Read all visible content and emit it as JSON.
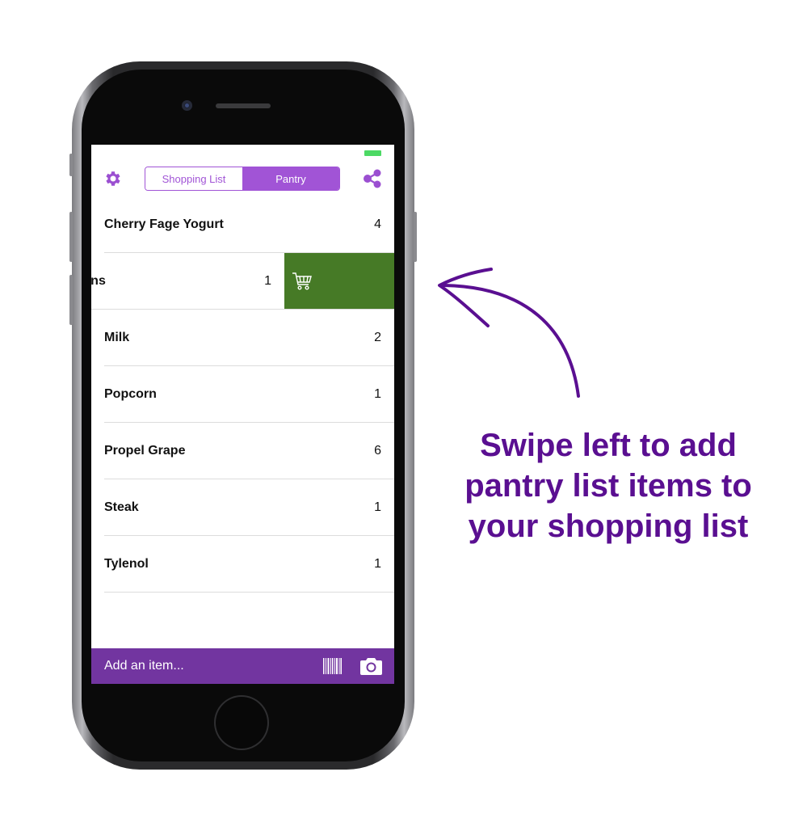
{
  "nav": {
    "segments": [
      {
        "label": "Shopping List",
        "active": false
      },
      {
        "label": "Pantry",
        "active": true
      }
    ],
    "settings_icon": "gear-icon",
    "share_icon": "share-icon"
  },
  "list": {
    "items": [
      {
        "name": "Cherry Fage Yogurt",
        "qty": "4"
      },
      {
        "name": "e Espresso Beans",
        "qty": "1",
        "swiped": true,
        "action_icon": "cart-icon"
      },
      {
        "name": "Milk",
        "qty": "2"
      },
      {
        "name": "Popcorn",
        "qty": "1"
      },
      {
        "name": "Propel Grape",
        "qty": "6"
      },
      {
        "name": "Steak",
        "qty": "1"
      },
      {
        "name": "Tylenol",
        "qty": "1"
      }
    ]
  },
  "bottom_bar": {
    "placeholder": "Add an item...",
    "barcode_icon": "barcode-icon",
    "camera_icon": "camera-icon"
  },
  "annotation": {
    "lines": [
      "Swipe left to add",
      "pantry list items to",
      "your shopping list"
    ]
  },
  "colors": {
    "accent": "#a154d6",
    "bottom_bar": "#7235a0",
    "swipe_action": "#467a26",
    "caption": "#5a0f91",
    "battery": "#4cd964"
  }
}
